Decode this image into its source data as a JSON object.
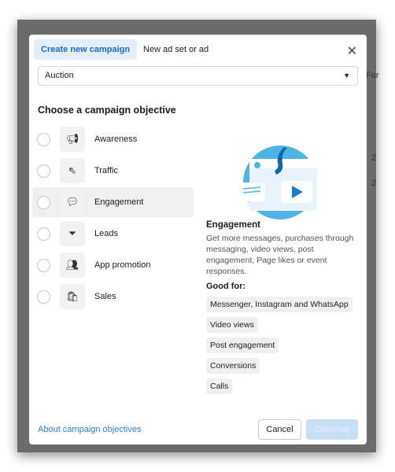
{
  "background": {
    "fragments": [
      "For",
      "2",
      "2"
    ]
  },
  "modal": {
    "tabs": [
      {
        "label": "Create new campaign",
        "active": true
      },
      {
        "label": "New ad set or ad",
        "active": false
      }
    ],
    "close_icon": "close-icon",
    "buying_type": {
      "value": "Auction"
    },
    "heading": "Choose a campaign objective",
    "objectives": [
      {
        "label": "Awareness",
        "icon": "megaphone-icon",
        "selected": false
      },
      {
        "label": "Traffic",
        "icon": "cursor-icon",
        "selected": false
      },
      {
        "label": "Engagement",
        "icon": "chat-bubbles-icon",
        "selected": true
      },
      {
        "label": "Leads",
        "icon": "funnel-icon",
        "selected": false
      },
      {
        "label": "App promotion",
        "icon": "people-icon",
        "selected": false
      },
      {
        "label": "Sales",
        "icon": "shopping-bag-icon",
        "selected": false
      }
    ],
    "detail": {
      "title": "Engagement",
      "description": "Get more messages, purchases through messaging, video views, post engagement, Page likes or event responses.",
      "good_for_label": "Good for:",
      "good_for": [
        "Messenger, Instagram and WhatsApp",
        "Video views",
        "Post engagement",
        "Conversions",
        "Calls"
      ]
    },
    "footer": {
      "link": "About campaign objectives",
      "cancel": "Cancel",
      "continue": "Continue",
      "continue_disabled": true
    },
    "colors": {
      "accent": "#1a6fbf",
      "illustration": "#4fb3e6"
    }
  }
}
